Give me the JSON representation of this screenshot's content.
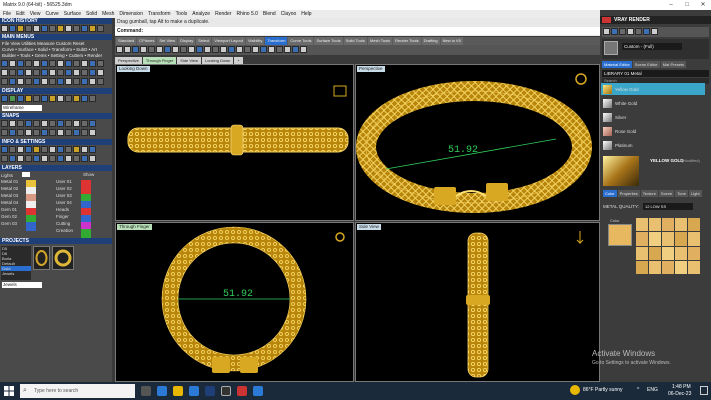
{
  "titlebar": {
    "title": "Matrix 9.0 (64-bit) - 56525.3dm"
  },
  "menubar": [
    "File",
    "Edit",
    "View",
    "Curve",
    "Surface",
    "Solid",
    "Mesh",
    "Dimension",
    "Transform",
    "Tools",
    "Analyze",
    "Render",
    "Rhino 5.0",
    "Blend",
    "Clayoo",
    "Help"
  ],
  "left": {
    "icon_history": "ICON HISTORY",
    "main_menus": "MAIN MENUS",
    "main_menu_row1": "File  View  Utilities  Measure  Custom      Reset",
    "main_menu_row2": "Curve • Surface • Solid • Transform • SubD  • Art",
    "main_menu_row3": "Builder • Tools • Gems • Setting • Cutters • Render",
    "display": "DISPLAY",
    "display_mode": "Wireframe",
    "snaps": "SNAPS",
    "info_settings": "INFO & SETTINGS",
    "layers": "LAYERS",
    "layers_lights": "Lights",
    "layers_show": "Show",
    "layers_left": [
      "Metal 01",
      "Metal 02",
      "Metal 03",
      "Metal 04",
      "Gem 01",
      "Gem 02",
      "Gem 03"
    ],
    "layers_right": [
      "User 01",
      "User 02",
      "User 03",
      "User 04",
      "Heads",
      "Finger",
      "Cutting",
      "Creation"
    ],
    "projects": "PROJECTS",
    "project_list": [
      "D5",
      "D6",
      "Borla",
      "Default",
      "Gold",
      "Jewels"
    ],
    "project_footer": "Jewels"
  },
  "command": {
    "line1": "Drag gumball, tap Alt to make a duplicate.",
    "line2": "Command:"
  },
  "toolbar_tabs": [
    "Standard",
    "CPlanes",
    "Set View",
    "Display",
    "Select",
    "Viewport Layout",
    "Visibility",
    "Transform",
    "Curve Tools",
    "Surface Tools",
    "Solid Tools",
    "Mesh Tools",
    "Render Tools",
    "Drafting",
    "New in V5"
  ],
  "active_toolbar_tab": "Transform",
  "viewport_tabs": [
    "Perspective",
    "Through Finger",
    "Side View",
    "Looking Down",
    "+"
  ],
  "active_viewport_tab": "Through Finger",
  "viewports": {
    "tl": {
      "label": "Looking Down"
    },
    "tr": {
      "label": "Perspective",
      "dim": "51.92"
    },
    "bl": {
      "label": "Through Finger",
      "dim": "51.92"
    },
    "br": {
      "label": "Side View"
    }
  },
  "right": {
    "header": "VRAY RENDER",
    "preset": "Custom - (Full)",
    "tabs": [
      "Material Editor",
      "Scene Editor",
      "Mat Presets"
    ],
    "library": "LIBRARY 01 Metal",
    "search_label": "Search",
    "materials": [
      "Yellow Gold",
      "White Gold",
      "Silver",
      "Rose Gold",
      "Platinum"
    ],
    "selected_material": "Yellow Gold",
    "preview_title": "YELLOW GOLD",
    "preview_sub": "(Modified)",
    "subtabs": [
      "Color",
      "Properties",
      "Texture",
      "Scene",
      "Tone",
      "Light"
    ],
    "metal_quality_label": "METAL QUALITY:",
    "metal_quality_value": "12 LOW SS",
    "color_label": "Color"
  },
  "watermark": {
    "line1": "Activate Windows",
    "line2": "Go to Settings to activate Windows."
  },
  "taskbar": {
    "search_placeholder": "Type here to search",
    "weather": "86°F Partly sunny",
    "time": "1:48 PM",
    "date": "06-Dec-23",
    "lang": "ENG"
  },
  "colors": {
    "accent": "#1f3f78",
    "gold": "#c9a227",
    "dim_green": "#2fd05a"
  }
}
